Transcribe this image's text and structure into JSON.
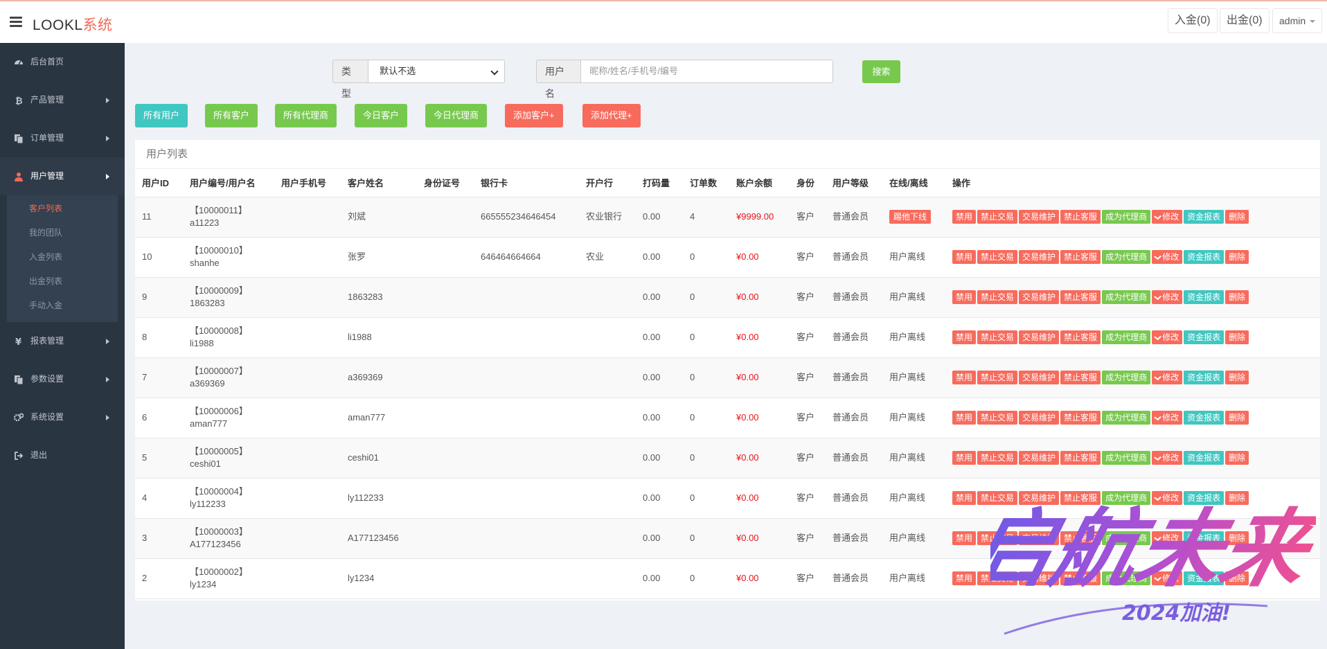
{
  "header": {
    "logo_main": "LOOKL",
    "logo_accent": "系统",
    "deposit_label": "入金(0)",
    "withdraw_label": "出金(0)",
    "admin_label": "admin"
  },
  "sidebar": {
    "items": [
      {
        "label": "后台首页",
        "icon": "dashboard-icon"
      },
      {
        "label": "产品管理",
        "icon": "bitcoin-icon"
      },
      {
        "label": "订单管理",
        "icon": "copy-icon"
      },
      {
        "label": "用户管理",
        "icon": "user-icon"
      },
      {
        "label": "报表管理",
        "icon": "yen-icon"
      },
      {
        "label": "参数设置",
        "icon": "copy-icon"
      },
      {
        "label": "系统设置",
        "icon": "gears-icon"
      },
      {
        "label": "退出",
        "icon": "sign-out-icon"
      }
    ],
    "submenu": [
      "客户列表",
      "我的团队",
      "入金列表",
      "出金列表",
      "手动入金"
    ]
  },
  "search": {
    "type_label": "类型",
    "type_selected": "默认不选",
    "user_label": "用户名",
    "user_placeholder": "昵称/姓名/手机号/编号",
    "search_label": "搜索"
  },
  "filters": {
    "all_users": "所有用户",
    "all_customers": "所有客户",
    "all_agents": "所有代理商",
    "today_customers": "今日客户",
    "today_agents": "今日代理商",
    "add_customer": "添加客户+",
    "add_agent": "添加代理+"
  },
  "table": {
    "title": "用户列表",
    "headers": [
      "用户ID",
      "用户编号/用户名",
      "用户手机号",
      "客户姓名",
      "身份证号",
      "银行卡",
      "开户行",
      "打码量",
      "订单数",
      "账户余额",
      "身份",
      "用户等级",
      "在线/离线",
      "操作"
    ],
    "actions": {
      "disable": "禁用",
      "ban_trade": "禁止交易",
      "trade_maint": "交易维护",
      "ban_service": "禁止客服",
      "to_agent": "成为代理商",
      "edit": "修改",
      "fund_report": "资金报表",
      "delete": "删除"
    },
    "rows": [
      {
        "id": "11",
        "code": "【10000011】",
        "username": "a11223",
        "phone": "",
        "name": "刘斌",
        "idcard": "",
        "bank_card": "665555234646454",
        "bank": "农业银行",
        "bet": "0.00",
        "orders": "4",
        "balance": "¥9999.00",
        "role": "客户",
        "level": "普通会员",
        "online": "踢他下线",
        "online_is_button": true
      },
      {
        "id": "10",
        "code": "【10000010】",
        "username": "shanhe",
        "phone": "",
        "name": "张罗",
        "idcard": "",
        "bank_card": "646464664664",
        "bank": "农业",
        "bet": "0.00",
        "orders": "0",
        "balance": "¥0.00",
        "role": "客户",
        "level": "普通会员",
        "online": "用户离线"
      },
      {
        "id": "9",
        "code": "【10000009】",
        "username": "1863283",
        "phone": "",
        "name": "1863283",
        "idcard": "",
        "bank_card": "",
        "bank": "",
        "bet": "0.00",
        "orders": "0",
        "balance": "¥0.00",
        "role": "客户",
        "level": "普通会员",
        "online": "用户离线"
      },
      {
        "id": "8",
        "code": "【10000008】",
        "username": "li1988",
        "phone": "",
        "name": "li1988",
        "idcard": "",
        "bank_card": "",
        "bank": "",
        "bet": "0.00",
        "orders": "0",
        "balance": "¥0.00",
        "role": "客户",
        "level": "普通会员",
        "online": "用户离线"
      },
      {
        "id": "7",
        "code": "【10000007】",
        "username": "a369369",
        "phone": "",
        "name": "a369369",
        "idcard": "",
        "bank_card": "",
        "bank": "",
        "bet": "0.00",
        "orders": "0",
        "balance": "¥0.00",
        "role": "客户",
        "level": "普通会员",
        "online": "用户离线"
      },
      {
        "id": "6",
        "code": "【10000006】",
        "username": "aman777",
        "phone": "",
        "name": "aman777",
        "idcard": "",
        "bank_card": "",
        "bank": "",
        "bet": "0.00",
        "orders": "0",
        "balance": "¥0.00",
        "role": "客户",
        "level": "普通会员",
        "online": "用户离线"
      },
      {
        "id": "5",
        "code": "【10000005】",
        "username": "ceshi01",
        "phone": "",
        "name": "ceshi01",
        "idcard": "",
        "bank_card": "",
        "bank": "",
        "bet": "0.00",
        "orders": "0",
        "balance": "¥0.00",
        "role": "客户",
        "level": "普通会员",
        "online": "用户离线"
      },
      {
        "id": "4",
        "code": "【10000004】",
        "username": "ly112233",
        "phone": "",
        "name": "ly112233",
        "idcard": "",
        "bank_card": "",
        "bank": "",
        "bet": "0.00",
        "orders": "0",
        "balance": "¥0.00",
        "role": "客户",
        "level": "普通会员",
        "online": "用户离线"
      },
      {
        "id": "3",
        "code": "【10000003】",
        "username": "A177123456",
        "phone": "",
        "name": "A177123456",
        "idcard": "",
        "bank_card": "",
        "bank": "",
        "bet": "0.00",
        "orders": "0",
        "balance": "¥0.00",
        "role": "客户",
        "level": "普通会员",
        "online": "用户离线"
      },
      {
        "id": "2",
        "code": "【10000002】",
        "username": "ly1234",
        "phone": "",
        "name": "ly1234",
        "idcard": "",
        "bank_card": "",
        "bank": "",
        "bet": "0.00",
        "orders": "0",
        "balance": "¥0.00",
        "role": "客户",
        "level": "普通会员",
        "online": "用户离线"
      }
    ]
  },
  "watermark": {
    "main": "启航未来",
    "sub": "2024加油!"
  },
  "colors": {
    "sidebar_bg": "#2a3542",
    "accent_red": "#f76b5d",
    "accent_green": "#77c94e",
    "accent_teal": "#40c7c1",
    "balance_red": "#e8141a"
  }
}
